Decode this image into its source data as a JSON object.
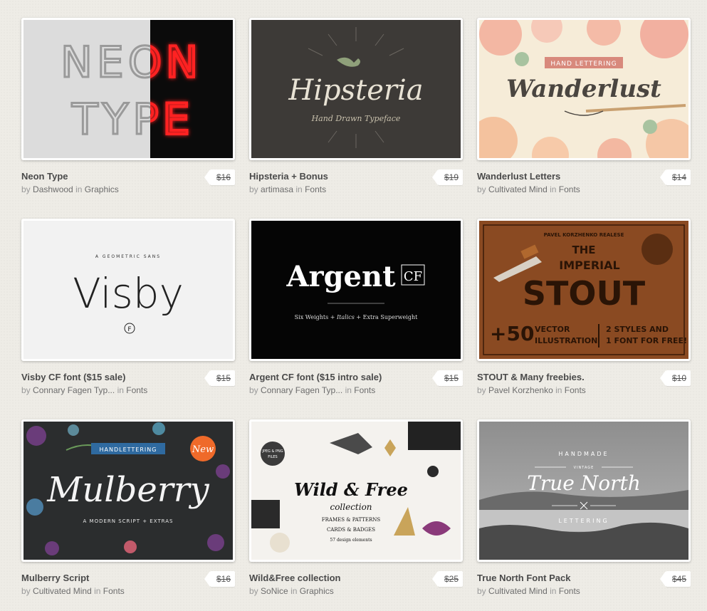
{
  "labels": {
    "by": "by",
    "in": "in"
  },
  "products": [
    {
      "title": "Neon Type",
      "author": "Dashwood",
      "category": "Graphics",
      "price": "$16",
      "art": {
        "words": [
          "NEON",
          "TYPE"
        ]
      }
    },
    {
      "title": "Hipsteria + Bonus",
      "author": "artimasa",
      "category": "Fonts",
      "price": "$19",
      "art": {
        "headline": "Hipsteria",
        "subline": "Hand Drawn Typeface"
      }
    },
    {
      "title": "Wanderlust Letters",
      "author": "Cultivated Mind",
      "category": "Fonts",
      "price": "$14",
      "art": {
        "ribbon": "HAND LETTERING",
        "headline": "Wanderlust"
      }
    },
    {
      "title": "Visby CF font ($15 sale)",
      "author": "Connary Fagen Typ...",
      "category": "Fonts",
      "price": "$15",
      "art": {
        "tagline": "A GEOMETRIC SANS",
        "headline": "Visby",
        "mark": "F"
      }
    },
    {
      "title": "Argent CF font ($15 intro sale)",
      "author": "Connary Fagen Typ...",
      "category": "Fonts",
      "price": "$15",
      "art": {
        "headline": "Argent",
        "badge": "CF",
        "line_a": "Six Weights + ",
        "line_b": "Italics",
        "line_c": " + Extra Superweight"
      }
    },
    {
      "title": "STOUT & Many freebies.",
      "author": "Pavel Korzhenko",
      "category": "Fonts",
      "price": "$10",
      "art": {
        "top": "PAVEL KORZHENKO REALESE",
        "the": "THE",
        "imperial": "IMPERIAL",
        "stout": "STOUT",
        "plus": "+50",
        "vector": "VECTOR",
        "illustration": "ILLUSTRATION",
        "styles": "2 STYLES AND",
        "free": "1 FONT FOR FREE!"
      }
    },
    {
      "title": "Mulberry Script",
      "author": "Cultivated Mind",
      "category": "Fonts",
      "price": "$16",
      "art": {
        "ribbon": "HANDLETTERING",
        "badge": "New",
        "headline": "Mulberry",
        "subline": "A MODERN SCRIPT + EXTRAS"
      }
    },
    {
      "title": "Wild&Free collection",
      "author": "SoNice",
      "category": "Graphics",
      "price": "$25",
      "art": {
        "circle_a": "JPEG & PNG",
        "circle_b": "FILES",
        "headline": "Wild & Free",
        "line1": "collection",
        "line2": "FRAMES & PATTERNS",
        "line3": "CARDS & BADGES",
        "line4": "57 design elements"
      }
    },
    {
      "title": "True North Font Pack",
      "author": "Cultivated Mind",
      "category": "Fonts",
      "price": "$45",
      "art": {
        "top": "HANDMADE",
        "vintage": "VINTAGE",
        "headline": "True North",
        "bottom": "LETTERING"
      }
    }
  ]
}
